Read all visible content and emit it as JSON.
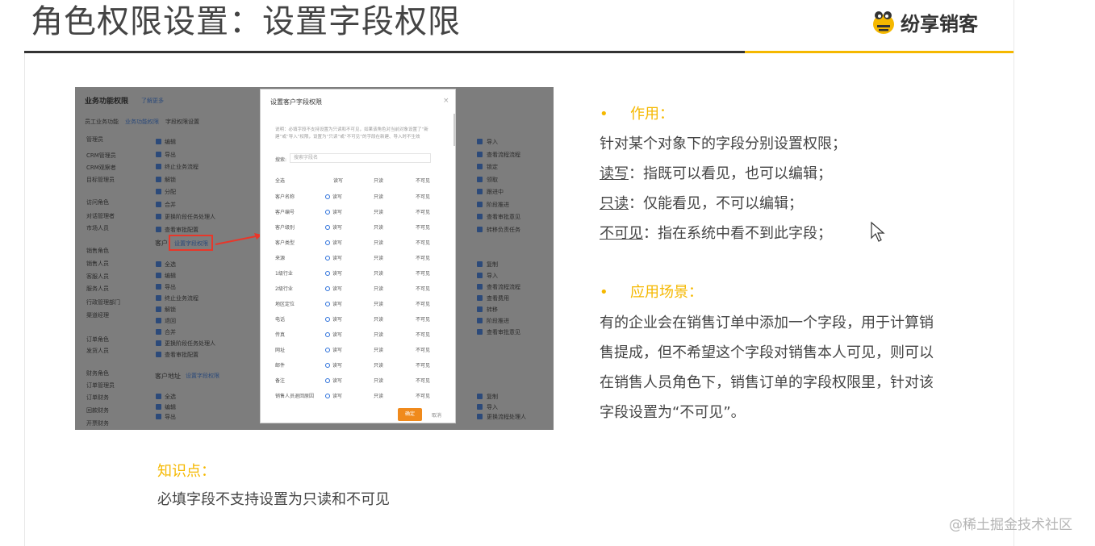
{
  "header": {
    "title": "角色权限设置：设置字段权限",
    "logo_text": "纷享销客",
    "accent_color": "#f5b800"
  },
  "screenshot": {
    "bg_heading": "业务功能权限",
    "bg_heading_link": "了解更多",
    "bg_tabs": [
      "员工业务功能",
      "业务功能权限",
      "字段权限设置"
    ],
    "bg_sidebar": [
      "管理员",
      "CRM管理员",
      "CRM观察者",
      "目标管理员",
      "访问角色",
      "对话管理者",
      "市场人员",
      "销售角色",
      "销售人员",
      "客服人员",
      "服务人员",
      "行政管理部门",
      "渠道经理",
      "订单角色",
      "发货人员",
      "财务角色",
      "订单管理员",
      "订单财务",
      "回款财务",
      "开票财务"
    ],
    "bg_col1": [
      "编辑",
      "导出",
      "终止业务流程",
      "解锁",
      "分配",
      "合并",
      "更换阶段任务处理人",
      "查看审批配置"
    ],
    "bg_section_customer": "客户",
    "bg_link_field_perm": "设置字段权限",
    "bg_col1b": [
      "全选",
      "编辑",
      "导出",
      "终止业务流程",
      "解锁",
      "退回",
      "合并",
      "更换阶段任务处理人",
      "查看审批配置"
    ],
    "bg_section_address": "客户地址",
    "bg_link_field_perm2": "设置字段权限",
    "bg_col1c": [
      "全选",
      "编辑",
      "导出"
    ],
    "bg_col3": [
      "导入",
      "查看流程流程",
      "锁定",
      "领取",
      "跟进中",
      "阶段推进",
      "查看审批意见",
      "转移负责任务"
    ],
    "bg_col3b": [
      "复制",
      "导入",
      "查看流程流程",
      "查看费用",
      "转移",
      "阶段推进",
      "查看审批意见"
    ],
    "bg_col3c": [
      "复制",
      "导入",
      "更换流程处理人"
    ],
    "modal": {
      "title": "设置客户字段权限",
      "close": "×",
      "note": "说明：必填字段不支持设置为只读和不可见，如果该角色对当前对象设置了“新建”或“导入”权限，设置为“只读”或“不可见”的字段在新建、导入时不生效",
      "search_label": "搜索:",
      "search_placeholder": "搜索字段名",
      "header_row": [
        "全选",
        "读写",
        "只读",
        "不可见"
      ],
      "rows": [
        {
          "name": "客户名称",
          "rw": "读写",
          "ro": "只读",
          "hidden": "不可见"
        },
        {
          "name": "客户编号",
          "rw": "读写",
          "ro": "只读",
          "hidden": "不可见"
        },
        {
          "name": "客户级别",
          "rw": "读写",
          "ro": "只读",
          "hidden": "不可见"
        },
        {
          "name": "客户类型",
          "rw": "读写",
          "ro": "只读",
          "hidden": "不可见"
        },
        {
          "name": "来源",
          "rw": "读写",
          "ro": "只读",
          "hidden": "不可见"
        },
        {
          "name": "1级行业",
          "rw": "读写",
          "ro": "只读",
          "hidden": "不可见"
        },
        {
          "name": "2级行业",
          "rw": "读写",
          "ro": "只读",
          "hidden": "不可见"
        },
        {
          "name": "地区定位",
          "rw": "读写",
          "ro": "只读",
          "hidden": "不可见"
        },
        {
          "name": "电话",
          "rw": "读写",
          "ro": "只读",
          "hidden": "不可见"
        },
        {
          "name": "传真",
          "rw": "读写",
          "ro": "只读",
          "hidden": "不可见"
        },
        {
          "name": "网址",
          "rw": "读写",
          "ro": "只读",
          "hidden": "不可见"
        },
        {
          "name": "邮件",
          "rw": "读写",
          "ro": "只读",
          "hidden": "不可见"
        },
        {
          "name": "备注",
          "rw": "读写",
          "ro": "只读",
          "hidden": "不可见"
        },
        {
          "name": "销售人员退回原因",
          "rw": "读写",
          "ro": "只读",
          "hidden": "不可见"
        }
      ],
      "ok": "确定",
      "cancel": "取消"
    }
  },
  "right": {
    "bullet": "•",
    "section1_title": "作用：",
    "section1_lines": [
      "针对某个对象下的字段分别设置权限；",
      {
        "u": "读写",
        "rest": "：指既可以看见，也可以编辑；"
      },
      {
        "u": "只读",
        "rest": "：仅能看见，不可以编辑；"
      },
      {
        "u": "不可见",
        "rest": "：指在系统中看不到此字段；"
      }
    ],
    "section2_title": "应用场景：",
    "section2_lines": [
      "有的企业会在销售订单中添加一个字段，用于计算销",
      "售提成，但不希望这个字段对销售本人可见，则可以",
      "在销售人员角色下，销售订单的字段权限里，针对该",
      "字段设置为“不可见”。"
    ]
  },
  "knowledge": {
    "title": "知识点：",
    "text": "必填字段不支持设置为只读和不可见"
  },
  "watermark": "@稀土掘金技术社区"
}
